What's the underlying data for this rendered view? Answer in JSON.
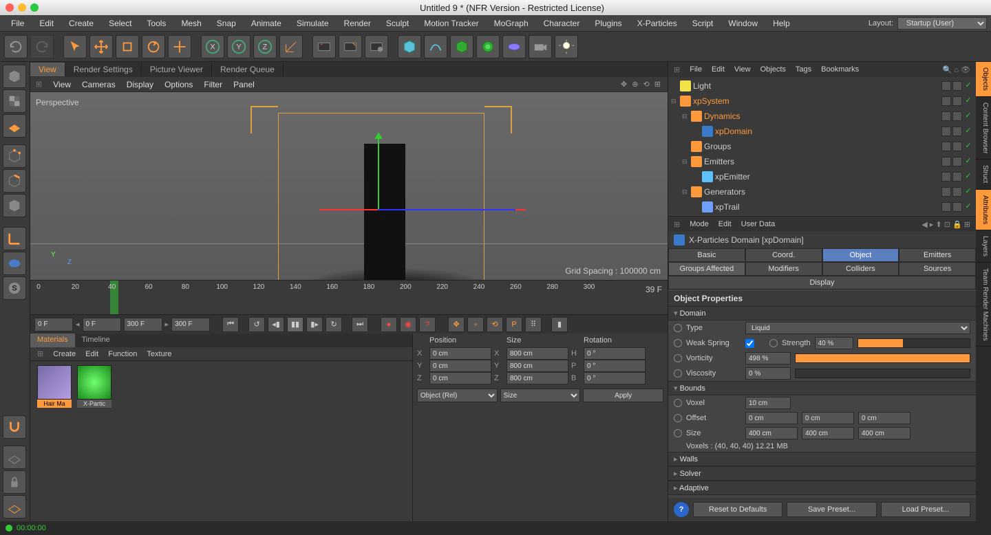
{
  "window": {
    "title": "Untitled 9 * (NFR Version - Restricted License)"
  },
  "menu": [
    "File",
    "Edit",
    "Create",
    "Select",
    "Tools",
    "Mesh",
    "Snap",
    "Animate",
    "Simulate",
    "Render",
    "Sculpt",
    "Motion Tracker",
    "MoGraph",
    "Character",
    "Plugins",
    "X-Particles",
    "Script",
    "Window",
    "Help"
  ],
  "layout": {
    "label": "Layout:",
    "value": "Startup (User)"
  },
  "view_tabs": [
    "View",
    "Render Settings",
    "Picture Viewer",
    "Render Queue"
  ],
  "view_menu": [
    "View",
    "Cameras",
    "Display",
    "Options",
    "Filter",
    "Panel"
  ],
  "viewport": {
    "label": "Perspective",
    "grid_spacing": "Grid Spacing : 100000 cm",
    "axis_y": "Y",
    "axis_z": "Z"
  },
  "timeline": {
    "ticks": [
      "0",
      "20",
      "40",
      "60",
      "80",
      "100",
      "120",
      "140",
      "160",
      "180",
      "200",
      "220",
      "240",
      "260",
      "280",
      "300"
    ],
    "current_frame": "39 F",
    "playhead_pos_pct": 13,
    "range_start": "0 F",
    "range_a": "0 F",
    "range_b": "300 F",
    "range_end": "300 F"
  },
  "materials": {
    "tabs": [
      "Materials",
      "Timeline"
    ],
    "menu": [
      "Create",
      "Edit",
      "Function",
      "Texture"
    ],
    "items": [
      {
        "name": "Hair Ma",
        "color": "#7a6aa8"
      },
      {
        "name": "X-Partic",
        "color": "#3fd13f"
      }
    ]
  },
  "coords": {
    "headers": [
      "Position",
      "Size",
      "Rotation"
    ],
    "rows": [
      {
        "a": "X",
        "av": "0 cm",
        "b": "X",
        "bv": "800 cm",
        "c": "H",
        "cv": "0 °"
      },
      {
        "a": "Y",
        "av": "0 cm",
        "b": "Y",
        "bv": "800 cm",
        "c": "P",
        "cv": "0 °"
      },
      {
        "a": "Z",
        "av": "0 cm",
        "b": "Z",
        "bv": "800 cm",
        "c": "B",
        "cv": "0 °"
      }
    ],
    "mode": "Object (Rel)",
    "sizemode": "Size",
    "apply": "Apply"
  },
  "object_manager": {
    "menu": [
      "File",
      "Edit",
      "View",
      "Objects",
      "Tags",
      "Bookmarks"
    ],
    "tree": [
      {
        "indent": 0,
        "exp": "",
        "icon": "#f4e24a",
        "name": "Light",
        "orange": false
      },
      {
        "indent": 0,
        "exp": "⊟",
        "icon": "#ff9a3c",
        "name": "xpSystem",
        "orange": true
      },
      {
        "indent": 1,
        "exp": "⊟",
        "icon": "#ff9a3c",
        "name": "Dynamics",
        "orange": true
      },
      {
        "indent": 2,
        "exp": "",
        "icon": "#3a7acb",
        "name": "xpDomain",
        "orange": true
      },
      {
        "indent": 1,
        "exp": "",
        "icon": "#ff9a3c",
        "name": "Groups",
        "orange": false
      },
      {
        "indent": 1,
        "exp": "⊟",
        "icon": "#ff9a3c",
        "name": "Emitters",
        "orange": false
      },
      {
        "indent": 2,
        "exp": "",
        "icon": "#5fc0ff",
        "name": "xpEmitter",
        "orange": false
      },
      {
        "indent": 1,
        "exp": "⊟",
        "icon": "#ff9a3c",
        "name": "Generators",
        "orange": false
      },
      {
        "indent": 2,
        "exp": "",
        "icon": "#6f9fff",
        "name": "xpTrail",
        "orange": false
      }
    ]
  },
  "attrs": {
    "menu": [
      "Mode",
      "Edit",
      "User Data"
    ],
    "title": "X-Particles Domain [xpDomain]",
    "tabs": [
      "Basic",
      "Coord.",
      "Object",
      "Emitters",
      "Groups Affected",
      "Modifiers",
      "Colliders",
      "Sources",
      "Display"
    ],
    "active_tab": "Object",
    "header": "Object Properties",
    "sections": {
      "domain": "Domain",
      "bounds": "Bounds",
      "walls": "Walls",
      "solver": "Solver",
      "adaptive": "Adaptive"
    },
    "domain": {
      "type_label": "Type",
      "type_value": "Liquid",
      "weak_label": "Weak Spring",
      "weak_checked": true,
      "strength_label": "Strength",
      "strength_value": "40 %",
      "strength_pct": 40,
      "vorticity_label": "Vorticity",
      "vorticity_value": "498 %",
      "vorticity_pct": 100,
      "viscosity_label": "Viscosity",
      "viscosity_value": "0 %",
      "viscosity_pct": 0
    },
    "bounds": {
      "voxel_label": "Voxel",
      "voxel_value": "10 cm",
      "offset_label": "Offset",
      "offset_x": "0 cm",
      "offset_y": "0 cm",
      "offset_z": "0 cm",
      "size_label": "Size",
      "size_x": "400 cm",
      "size_y": "400 cm",
      "size_z": "400 cm",
      "voxels_info": "Voxels : (40, 40, 40) 12.21 MB"
    },
    "buttons": {
      "reset": "Reset to Defaults",
      "save": "Save Preset...",
      "load": "Load Preset..."
    }
  },
  "right_tabs": [
    "Objects",
    "Content Browser",
    "Struct",
    "Attributes",
    "Layers",
    "Team Render Machines"
  ],
  "status": {
    "time": "00:00:00"
  }
}
